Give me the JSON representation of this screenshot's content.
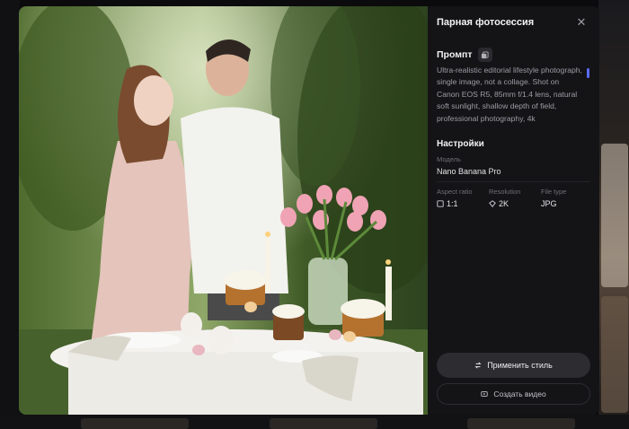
{
  "modal": {
    "title": "Парная фотосессия",
    "close_icon": "close-icon"
  },
  "prompt": {
    "label": "Промпт",
    "copy_icon": "copy-icon",
    "text": "Ultra-realistic editorial lifestyle photograph, single image, not a collage. Shot on Canon EOS R5, 85mm f/1.4 lens, natural soft sunlight, shallow depth of field, professional photography, 4k"
  },
  "settings": {
    "title": "Настройки",
    "model_label": "Модель",
    "model_value": "Nano Banana Pro",
    "aspect_label": "Aspect ratio",
    "aspect_value": "1:1",
    "resolution_label": "Resolution",
    "resolution_value": "2K",
    "filetype_label": "File type",
    "filetype_value": "JPG"
  },
  "actions": {
    "apply_label": "Применить стиль",
    "video_label": "Создать видео"
  },
  "colors": {
    "panel_bg": "#141417",
    "accent_scroll": "#5b6cff",
    "button_bg": "#2c2c31"
  }
}
